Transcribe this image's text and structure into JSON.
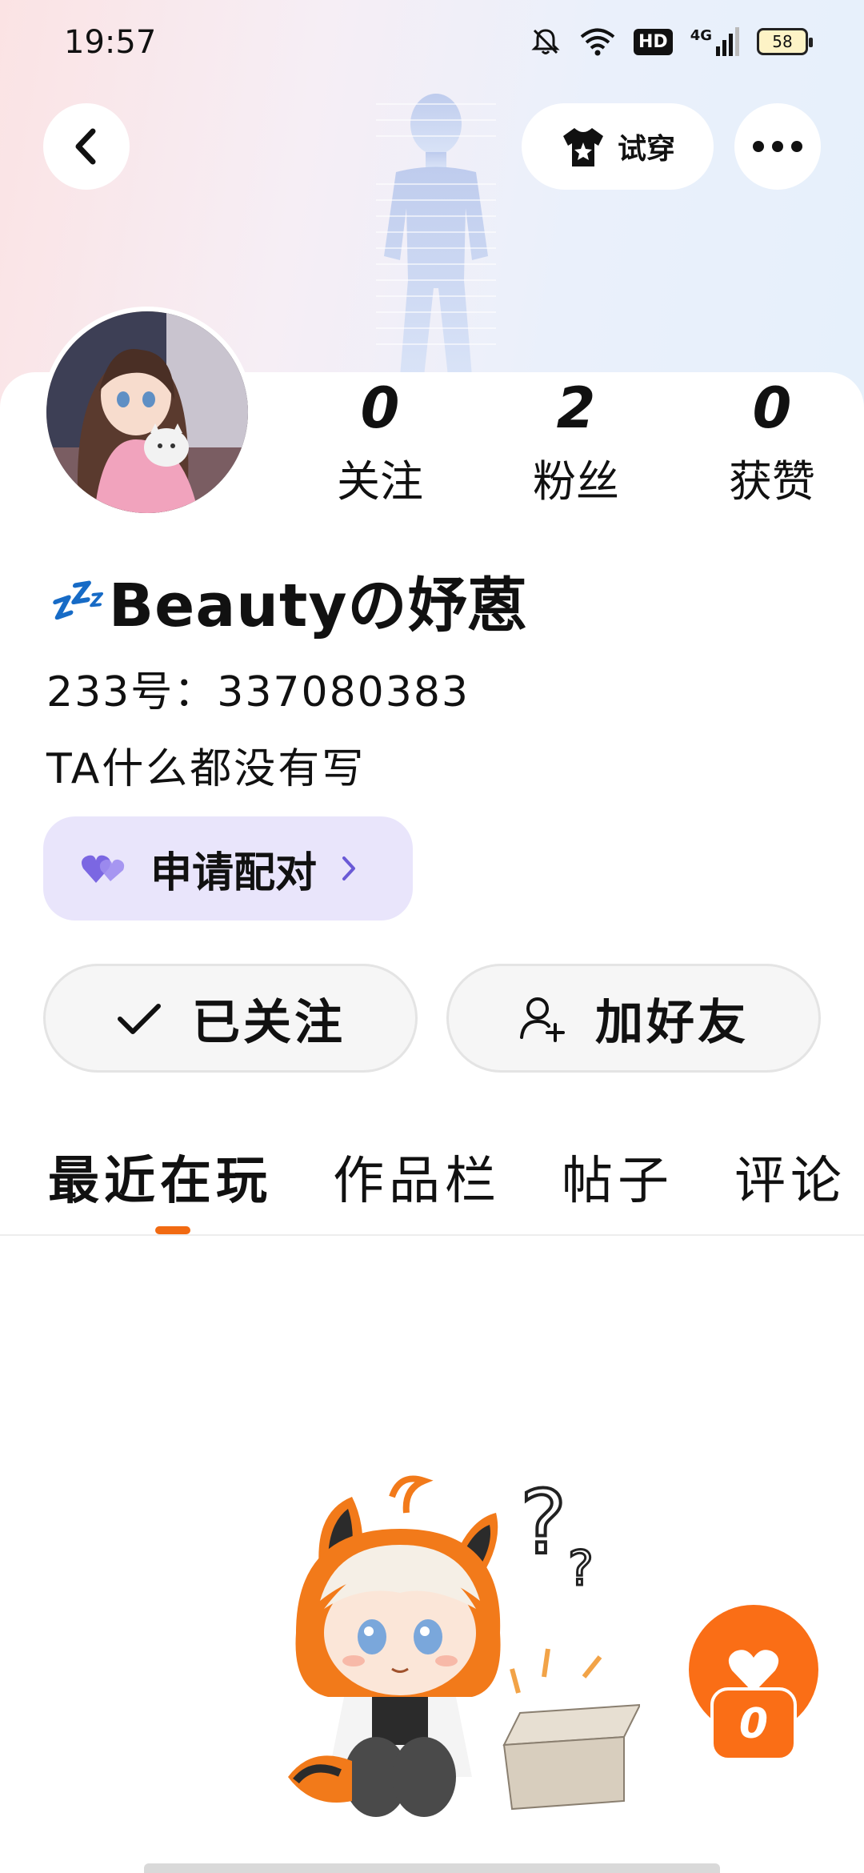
{
  "status_bar": {
    "time": "19:57",
    "hd": "HD",
    "network": "4G",
    "battery": "58"
  },
  "header": {
    "try_on_label": "试穿",
    "icons": [
      "back-icon",
      "tshirt-star-icon",
      "more-icon"
    ]
  },
  "profile": {
    "stats": [
      {
        "value": "0",
        "label": "关注"
      },
      {
        "value": "2",
        "label": "粉丝"
      },
      {
        "value": "0",
        "label": "获赞"
      }
    ],
    "username_emoji": "💤",
    "username": "Beautyの妤蒽",
    "id_line": "233号：337080383",
    "bio": "TA什么都没有写",
    "pair_button": "申请配对"
  },
  "actions": {
    "follow_label": "已关注",
    "add_friend_label": "加好友"
  },
  "tabs": [
    {
      "label": "最近在玩",
      "active": true
    },
    {
      "label": "作品栏",
      "active": false
    },
    {
      "label": "帖子",
      "active": false
    },
    {
      "label": "评论",
      "active": false
    }
  ],
  "float_button": {
    "badge": "0"
  },
  "colors": {
    "accent_orange": "#fa6e16",
    "pair_bg": "#e9e5fb",
    "pair_heart": "#6a5ad6"
  }
}
